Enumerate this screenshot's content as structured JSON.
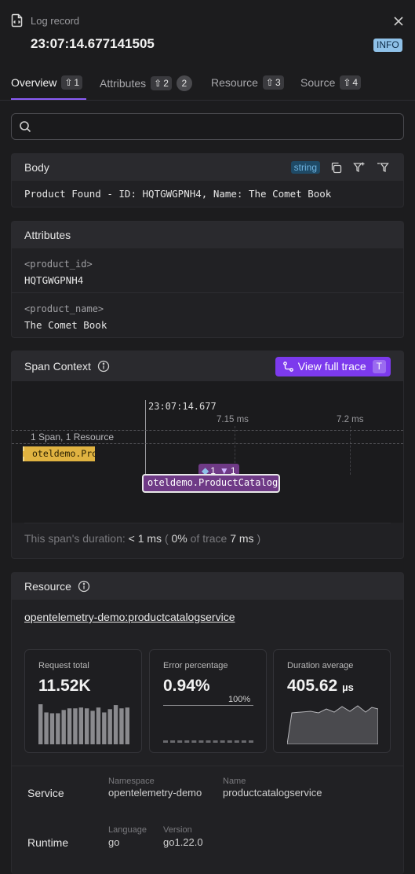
{
  "header": {
    "title": "Log record",
    "timestamp": "23:07:14.677141505",
    "severity": "INFO"
  },
  "tabs": [
    {
      "label": "Overview",
      "shortcut": "1"
    },
    {
      "label": "Attributes",
      "shortcut": "2",
      "count": "2"
    },
    {
      "label": "Resource",
      "shortcut": "3"
    },
    {
      "label": "Source",
      "shortcut": "4"
    }
  ],
  "search": {
    "placeholder": ""
  },
  "body_panel": {
    "title": "Body",
    "type_badge": "string",
    "content": "Product Found - ID: HQTGWGPNH4, Name: The Comet Book"
  },
  "attributes_panel": {
    "title": "Attributes",
    "items": [
      {
        "key": "<product_id>",
        "value": "HQTGWGPNH4"
      },
      {
        "key": "<product_name>",
        "value": "The Comet Book"
      }
    ]
  },
  "span_context": {
    "title": "Span Context",
    "view_trace_label": "View full trace",
    "view_trace_shortcut": "T",
    "cursor_time": "23:07:14.677",
    "tick_1": "7.15 ms",
    "tick_2": "7.2 ms",
    "summary": "1 Span, 1 Resource",
    "span_left_label": "oteldemo.Pro",
    "span_main_label": "oteldemo.ProductCatalogS",
    "span_badge_a": "1",
    "span_badge_b": "1",
    "duration_prefix": "This span's duration:",
    "duration_value": "< 1 ms",
    "paren_open": "(",
    "pct_value": "0%",
    "of_trace": "of trace",
    "trace_value": "7 ms",
    "paren_close": ")"
  },
  "resource_panel": {
    "title": "Resource",
    "link": "opentelemetry-demo:productcatalogservice",
    "stats": [
      {
        "label": "Request total",
        "value": "11.52K"
      },
      {
        "label": "Error percentage",
        "value": "0.94%",
        "max_label": "100%"
      },
      {
        "label": "Duration average",
        "value": "405.62",
        "unit": "µs"
      }
    ],
    "request_bars": [
      0.98,
      0.78,
      0.76,
      0.76,
      0.84,
      0.88,
      0.88,
      0.9,
      0.88,
      0.82,
      0.9,
      0.78,
      0.86,
      0.96,
      0.88,
      0.9
    ],
    "service": {
      "label": "Service",
      "namespace_label": "Namespace",
      "namespace_value": "opentelemetry-demo",
      "name_label": "Name",
      "name_value": "productcatalogservice"
    },
    "runtime": {
      "label": "Runtime",
      "language_label": "Language",
      "language_value": "go",
      "version_label": "Version",
      "version_value": "go1.22.0"
    }
  },
  "colors": {
    "accent": "#7c3aed",
    "info_badge": "#8fc1e8",
    "span_gold": "#e0b341",
    "span_purple": "#6f3a86"
  }
}
